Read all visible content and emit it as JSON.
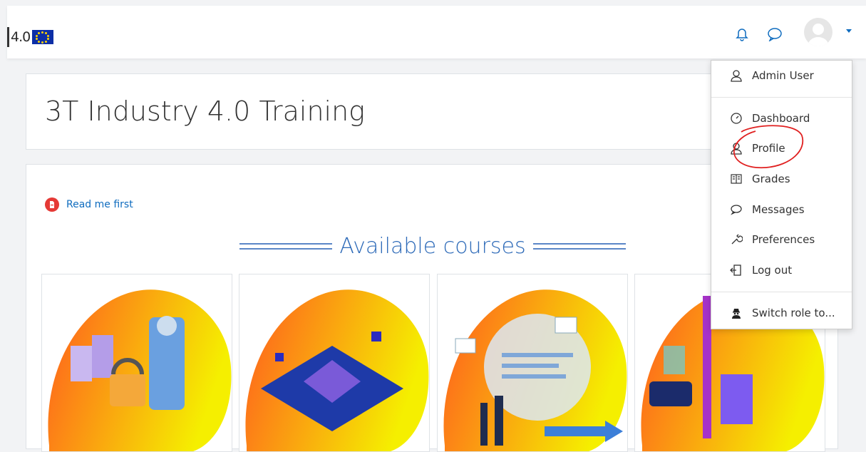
{
  "header": {
    "logo_text": "4.0",
    "icons": [
      "bell-icon",
      "chat-icon",
      "user-avatar",
      "caret-down-icon"
    ]
  },
  "page": {
    "title": "3T Industry 4.0 Training"
  },
  "main": {
    "read_me": "Read me first",
    "available_courses": "Available courses"
  },
  "user_menu": {
    "user_name": "Admin User",
    "items": [
      {
        "label": "Dashboard",
        "icon": "gauge-icon"
      },
      {
        "label": "Profile",
        "icon": "user-icon"
      },
      {
        "label": "Grades",
        "icon": "book-icon"
      },
      {
        "label": "Messages",
        "icon": "chat-icon"
      },
      {
        "label": "Preferences",
        "icon": "wrench-icon"
      },
      {
        "label": "Log out",
        "icon": "logout-icon"
      }
    ],
    "switch_role": "Switch role to..."
  },
  "colors": {
    "accent": "#0f6cbf",
    "blob_start": "#ff5a1f",
    "blob_end": "#f5ef00",
    "annotation": "#e02020"
  }
}
